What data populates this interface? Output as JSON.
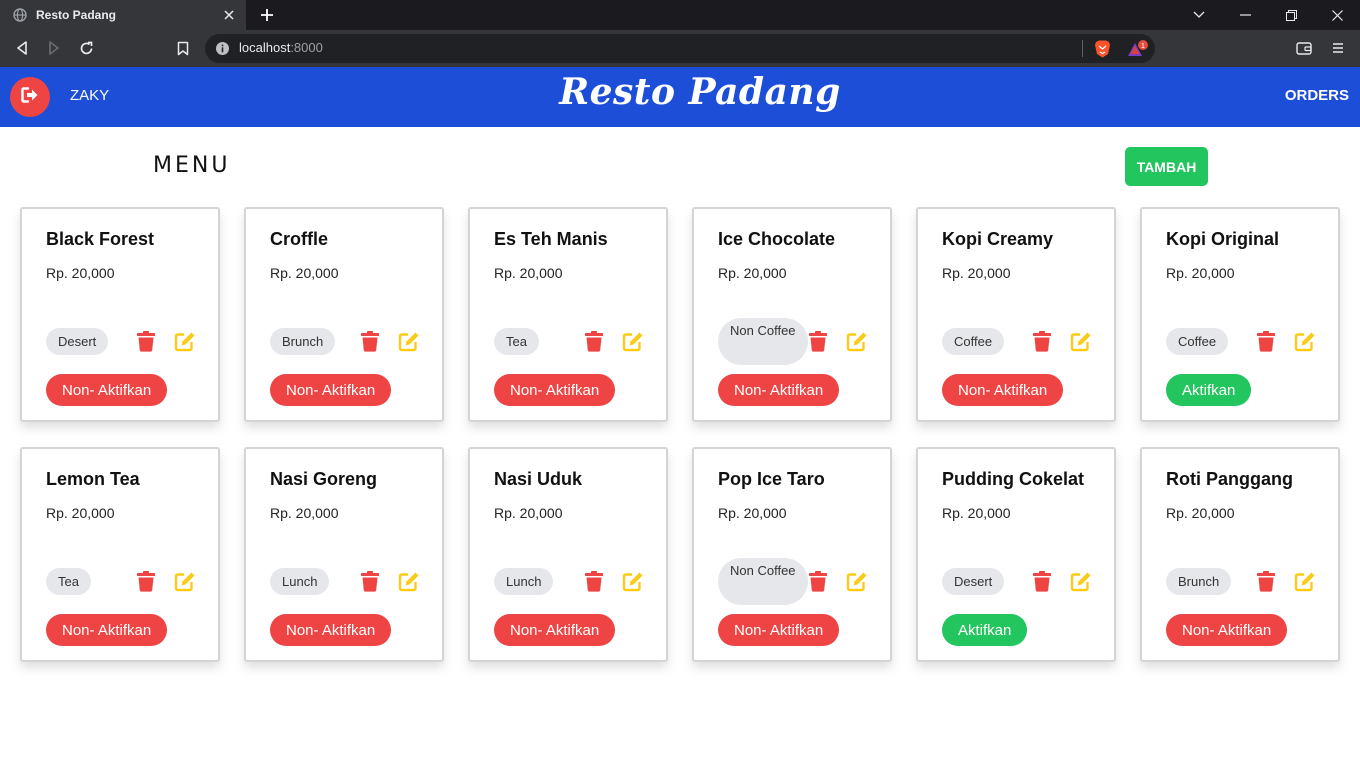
{
  "browser": {
    "tab_title": "Resto Padang",
    "url_host": "localhost",
    "url_port": ":8000",
    "rewards_count": "1"
  },
  "header": {
    "username": "ZAKY",
    "brand": "Resto Padang",
    "orders_label": "ORDERS"
  },
  "section": {
    "title": "MENU",
    "add_label": "TAMBAH"
  },
  "colors": {
    "header_bg": "#1d4ed8",
    "danger": "#ef4444",
    "success": "#22c55e",
    "edit": "#facc15",
    "badge_bg": "#e5e7eb"
  },
  "menu_items": [
    {
      "name": "Black Forest",
      "price": "Rp. 20,000",
      "category": "Desert",
      "action": "Non- Aktifkan",
      "active": true
    },
    {
      "name": "Croffle",
      "price": "Rp. 20,000",
      "category": "Brunch",
      "action": "Non- Aktifkan",
      "active": true
    },
    {
      "name": "Es Teh Manis",
      "price": "Rp. 20,000",
      "category": "Tea",
      "action": "Non- Aktifkan",
      "active": true
    },
    {
      "name": "Ice Chocolate",
      "price": "Rp. 20,000",
      "category": "Non Coffee",
      "action": "Non- Aktifkan",
      "active": true
    },
    {
      "name": "Kopi Creamy",
      "price": "Rp. 20,000",
      "category": "Coffee",
      "action": "Non- Aktifkan",
      "active": true
    },
    {
      "name": "Kopi Original",
      "price": "Rp. 20,000",
      "category": "Coffee",
      "action": "Aktifkan",
      "active": false
    },
    {
      "name": "Lemon Tea",
      "price": "Rp. 20,000",
      "category": "Tea",
      "action": "Non- Aktifkan",
      "active": true
    },
    {
      "name": "Nasi Goreng",
      "price": "Rp. 20,000",
      "category": "Lunch",
      "action": "Non- Aktifkan",
      "active": true
    },
    {
      "name": "Nasi Uduk",
      "price": "Rp. 20,000",
      "category": "Lunch",
      "action": "Non- Aktifkan",
      "active": true
    },
    {
      "name": "Pop Ice Taro",
      "price": "Rp. 20,000",
      "category": "Non Coffee",
      "action": "Non- Aktifkan",
      "active": true
    },
    {
      "name": "Pudding Cokelat",
      "price": "Rp. 20,000",
      "category": "Desert",
      "action": "Aktifkan",
      "active": false
    },
    {
      "name": "Roti Panggang",
      "price": "Rp. 20,000",
      "category": "Brunch",
      "action": "Non- Aktifkan",
      "active": true
    }
  ]
}
